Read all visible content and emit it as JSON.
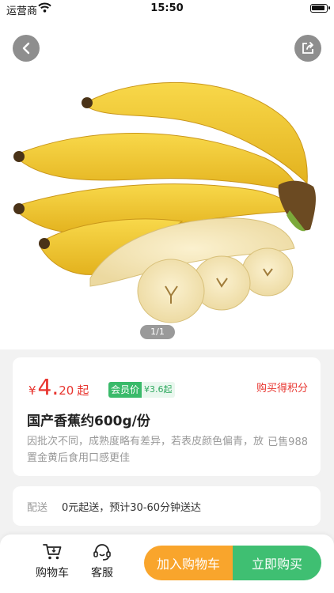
{
  "status_bar": {
    "carrier": "运营商",
    "time": "15:50"
  },
  "gallery": {
    "page_indicator": "1/1"
  },
  "price": {
    "currency": "¥",
    "integer": "4.",
    "decimal": "20",
    "unit": "起"
  },
  "member": {
    "label": "会员价",
    "price": "¥3.6起"
  },
  "points_link": "购买得积分",
  "product": {
    "title": "国产香蕉约600g/份",
    "description": "因批次不同，成熟度略有差异，若表皮颜色偏青，放置金黄后食用口感更佳",
    "sold": "已售988"
  },
  "delivery": {
    "label": "配送",
    "text": "0元起送，预计30-60分钟送达"
  },
  "bottom_bar": {
    "cart_label": "购物车",
    "service_label": "客服",
    "add_to_cart": "加入购物车",
    "buy_now": "立即购买"
  },
  "colors": {
    "price_red": "#e8352f",
    "member_green": "#3aba6a",
    "add_orange": "#f9a52c",
    "buy_green": "#3fbf72"
  },
  "icons": [
    "wifi-icon",
    "battery-icon",
    "back-arrow-icon",
    "share-icon",
    "cart-icon",
    "customer-service-icon"
  ]
}
